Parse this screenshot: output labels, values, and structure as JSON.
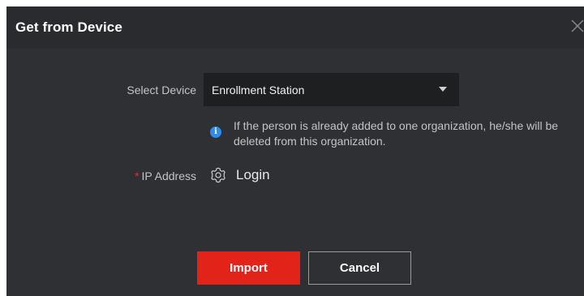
{
  "dialog": {
    "title": "Get from Device",
    "close_icon": "close-icon"
  },
  "form": {
    "select_device": {
      "label": "Select Device",
      "value": "Enrollment Station"
    },
    "hint": {
      "icon": "info-icon",
      "text": "If the person is already added to one organization, he/she will be deleted from this organization."
    },
    "ip_address": {
      "required_mark": "*",
      "label": "IP Address",
      "action_icon": "gear-icon",
      "action_label": "Login"
    }
  },
  "buttons": {
    "import_label": "Import",
    "cancel_label": "Cancel"
  },
  "colors": {
    "dialog_bg": "#2f3033",
    "primary": "#e1231a",
    "info": "#2d8cf0",
    "required": "#e02f2f"
  }
}
